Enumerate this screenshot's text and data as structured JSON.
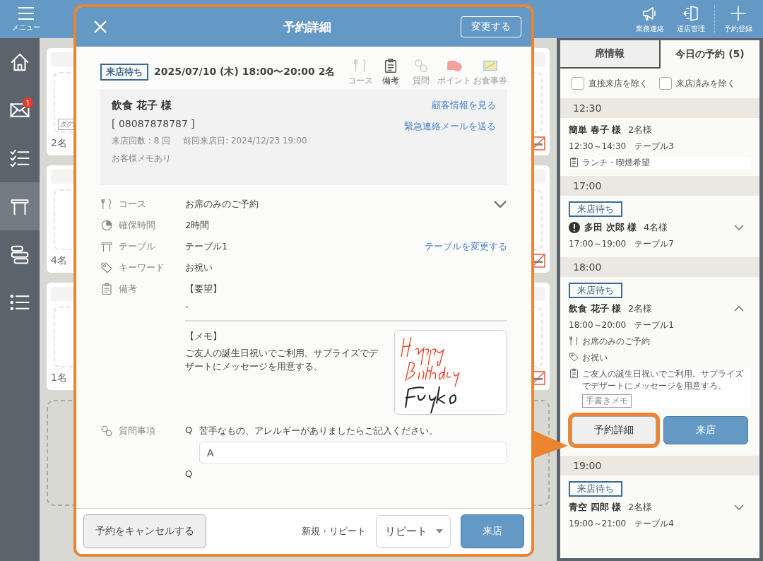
{
  "topbar": {
    "menu": {
      "label": "メニュー"
    },
    "actions": [
      {
        "label": "業務連絡"
      },
      {
        "label": "退店管理"
      },
      {
        "label": "予約登録"
      }
    ]
  },
  "sidebar": {
    "items": [
      {
        "selected": false
      },
      {
        "selected": false,
        "badge": "1"
      },
      {
        "selected": false
      },
      {
        "selected": true
      },
      {
        "selected": false
      },
      {
        "selected": false
      }
    ]
  },
  "floor": {
    "cards": [
      {
        "tag": "次の",
        "label": "2名"
      },
      {
        "label": "4名"
      },
      {
        "label": "1名"
      }
    ]
  },
  "modal": {
    "title": "予約詳細",
    "edit_button": "変更する",
    "status": "来店待ち",
    "datetime": "2025/07/10 (木) 18:00〜20:00 2名",
    "info_icons": [
      {
        "label": "コース",
        "active": false
      },
      {
        "label": "備考",
        "active": true
      },
      {
        "label": "質問",
        "active": false
      },
      {
        "label": "ポイント",
        "active": false
      },
      {
        "label": "お食事券",
        "active": false
      }
    ],
    "customer": {
      "name": "飲食 花子 様",
      "phone": "[ 08087878787 ]",
      "visits": "来店回数 : 8 回",
      "last_visit": "前回来店日:  2024/12/23 19:00",
      "memo": "お客様メモあり",
      "links": [
        "顧客情報を見る",
        "緊急連絡メールを送る"
      ]
    },
    "fields": [
      {
        "kind": "select",
        "label": "コース",
        "value": "お席のみのご予約"
      },
      {
        "kind": "text",
        "label": "確保時間",
        "value": "2時間"
      },
      {
        "kind": "link",
        "label": "テーブル",
        "value": "テーブル1",
        "link": "テーブルを変更する"
      },
      {
        "kind": "text",
        "label": "キーワード",
        "value": "お祝い"
      },
      {
        "kind": "notes",
        "label": "備考",
        "request_heading": "【要望】",
        "request": "-",
        "memo_heading": "【メモ】",
        "memo": "ご友人の誕生日祝いでご利用。サプライズでデザートにメッセージを用意する。"
      },
      {
        "kind": "qa",
        "label": "質問事項",
        "items": [
          {
            "q_mark": "Q",
            "question": "苦手なもの、アレルギーがありましたらご記入ください。",
            "answer": "A"
          },
          {
            "q_mark": "Q"
          }
        ]
      }
    ],
    "footer": {
      "cancel": "予約をキャンセルする",
      "type_label": "新規・リピート",
      "type_value": "リピート",
      "arrive": "来店"
    }
  },
  "right_panel": {
    "tabs": [
      {
        "label": "席情報",
        "selected": false
      },
      {
        "label": "今日の予約 (5)",
        "selected": true
      }
    ],
    "filters": [
      {
        "label": "直接来店を除く",
        "checked": false
      },
      {
        "label": "来店済みを除く",
        "checked": false
      }
    ],
    "groups": [
      {
        "time": "12:30",
        "reservations": [
          {
            "name": "簡単 春子 様",
            "party": "2名様",
            "time": "12:30～14:30",
            "table": "テーブル3",
            "details": [
              {
                "kind": "note",
                "text": "ランチ・喫煙希望"
              }
            ]
          }
        ]
      },
      {
        "time": "17:00",
        "reservations": [
          {
            "status": "来店待ち",
            "alert": true,
            "name": "多田 次郎 様",
            "party": "4名様",
            "time": "17:00～19:00",
            "table": "テーブル7",
            "expanded": false
          }
        ]
      },
      {
        "time": "18:00",
        "reservations": [
          {
            "status": "来店待ち",
            "alert": false,
            "name": "飲食 花子 様",
            "party": "2名様",
            "time": "18:00～20:00",
            "table": "テーブル1",
            "expanded": true,
            "details": [
              {
                "kind": "course",
                "text": "お席のみのご予約"
              },
              {
                "kind": "keyword",
                "text": "お祝い"
              },
              {
                "kind": "note",
                "text": "ご友人の誕生日祝いでご利用。サプライズでデザートにメッセージを用意すろ。",
                "tag": "手書きメモ"
              }
            ],
            "actions": [
              {
                "label": "予約詳細",
                "kind": "secondary",
                "highlighted": true
              },
              {
                "label": "来店",
                "kind": "primary",
                "highlighted": false
              }
            ]
          }
        ]
      },
      {
        "time": "19:00",
        "reservations": [
          {
            "status": "来店待ち",
            "alert": false,
            "name": "青空 四郎 様",
            "party": "2名様",
            "time": "19:00～21:00",
            "table": "テーブル4",
            "expanded": false
          }
        ]
      }
    ]
  }
}
